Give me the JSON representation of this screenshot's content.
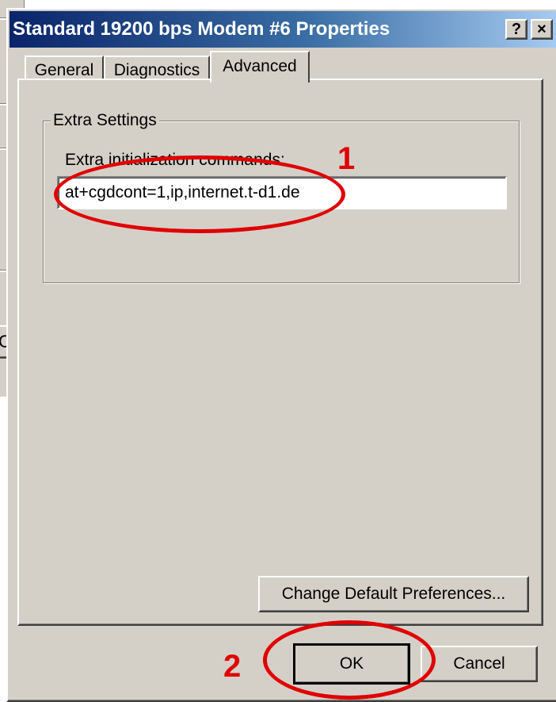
{
  "background_window": {
    "button_fragment": "Ca"
  },
  "dialog": {
    "title": "Standard 19200 bps Modem #6 Properties",
    "help_button": "?",
    "close_button": "×",
    "tabs": [
      {
        "label": "General",
        "selected": false
      },
      {
        "label": "Diagnostics",
        "selected": false
      },
      {
        "label": "Advanced",
        "selected": true
      }
    ],
    "group_label": "Extra Settings",
    "init_label": "Extra initialization commands:",
    "init_value": "at+cgdcont=1,ip,internet.t-d1.de",
    "change_defaults_button": "Change Default Preferences...",
    "ok_button": "OK",
    "cancel_button": "Cancel"
  },
  "annotations": [
    {
      "number": "1",
      "target": "init_value"
    },
    {
      "number": "2",
      "target": "ok_button"
    }
  ],
  "colors": {
    "face": "#d4d0c8",
    "title_start": "#0a246a",
    "title_end": "#a6caf0",
    "annotation": "#e00000"
  }
}
